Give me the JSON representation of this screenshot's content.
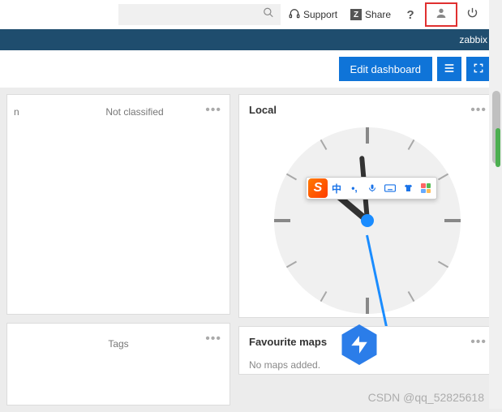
{
  "top": {
    "support": "Support",
    "share": "Share",
    "share_badge": "Z"
  },
  "bluebar": {
    "brand": "zabbix"
  },
  "actions": {
    "edit": "Edit dashboard"
  },
  "widgets": {
    "left1": {
      "col_n": "n",
      "col_nc": "Not classified"
    },
    "left2": {
      "col_tags": "Tags"
    },
    "local": {
      "title": "Local"
    },
    "favmaps": {
      "title": "Favourite maps",
      "msg": "No maps added."
    }
  },
  "ime": {
    "logo": "S",
    "zh": "中",
    "comma": "•,",
    "mic": "🎤",
    "kbd": "⌨",
    "shirt": "👕",
    "grid": "⊞"
  },
  "watermark": "CSDN @qq_52825618"
}
